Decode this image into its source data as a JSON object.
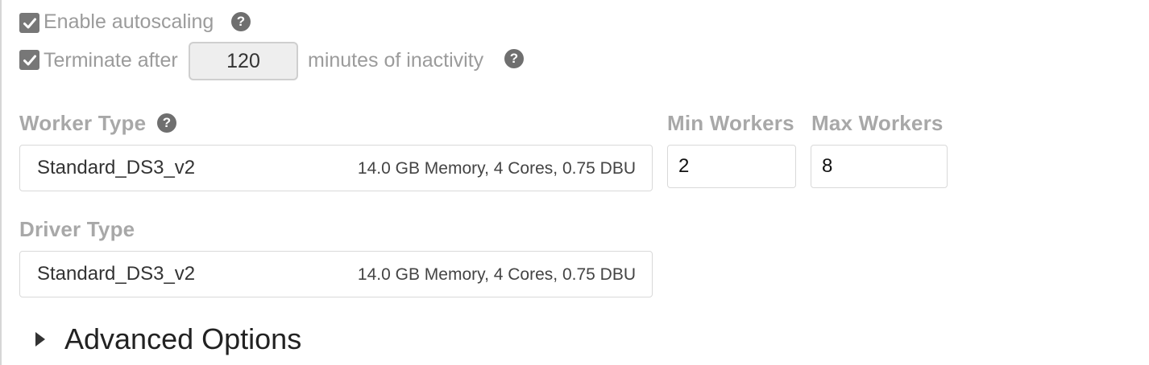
{
  "autoscaling": {
    "label": "Enable autoscaling",
    "checked": true,
    "help_icon": "question-circle-icon"
  },
  "terminate": {
    "label_before": "Terminate after",
    "minutes_value": "120",
    "label_after": "minutes of inactivity",
    "checked": true,
    "help_icon": "question-circle-icon"
  },
  "worker_type": {
    "label": "Worker Type",
    "help_icon": "question-circle-icon",
    "name": "Standard_DS3_v2",
    "details": "14.0 GB Memory, 4 Cores, 0.75 DBU"
  },
  "min_workers": {
    "label": "Min Workers",
    "value": "2"
  },
  "max_workers": {
    "label": "Max Workers",
    "value": "8"
  },
  "driver_type": {
    "label": "Driver Type",
    "name": "Standard_DS3_v2",
    "details": "14.0 GB Memory, 4 Cores, 0.75 DBU"
  },
  "advanced_options": {
    "label": "Advanced Options",
    "icon": "caret-right-icon"
  },
  "help_glyph": "?"
}
